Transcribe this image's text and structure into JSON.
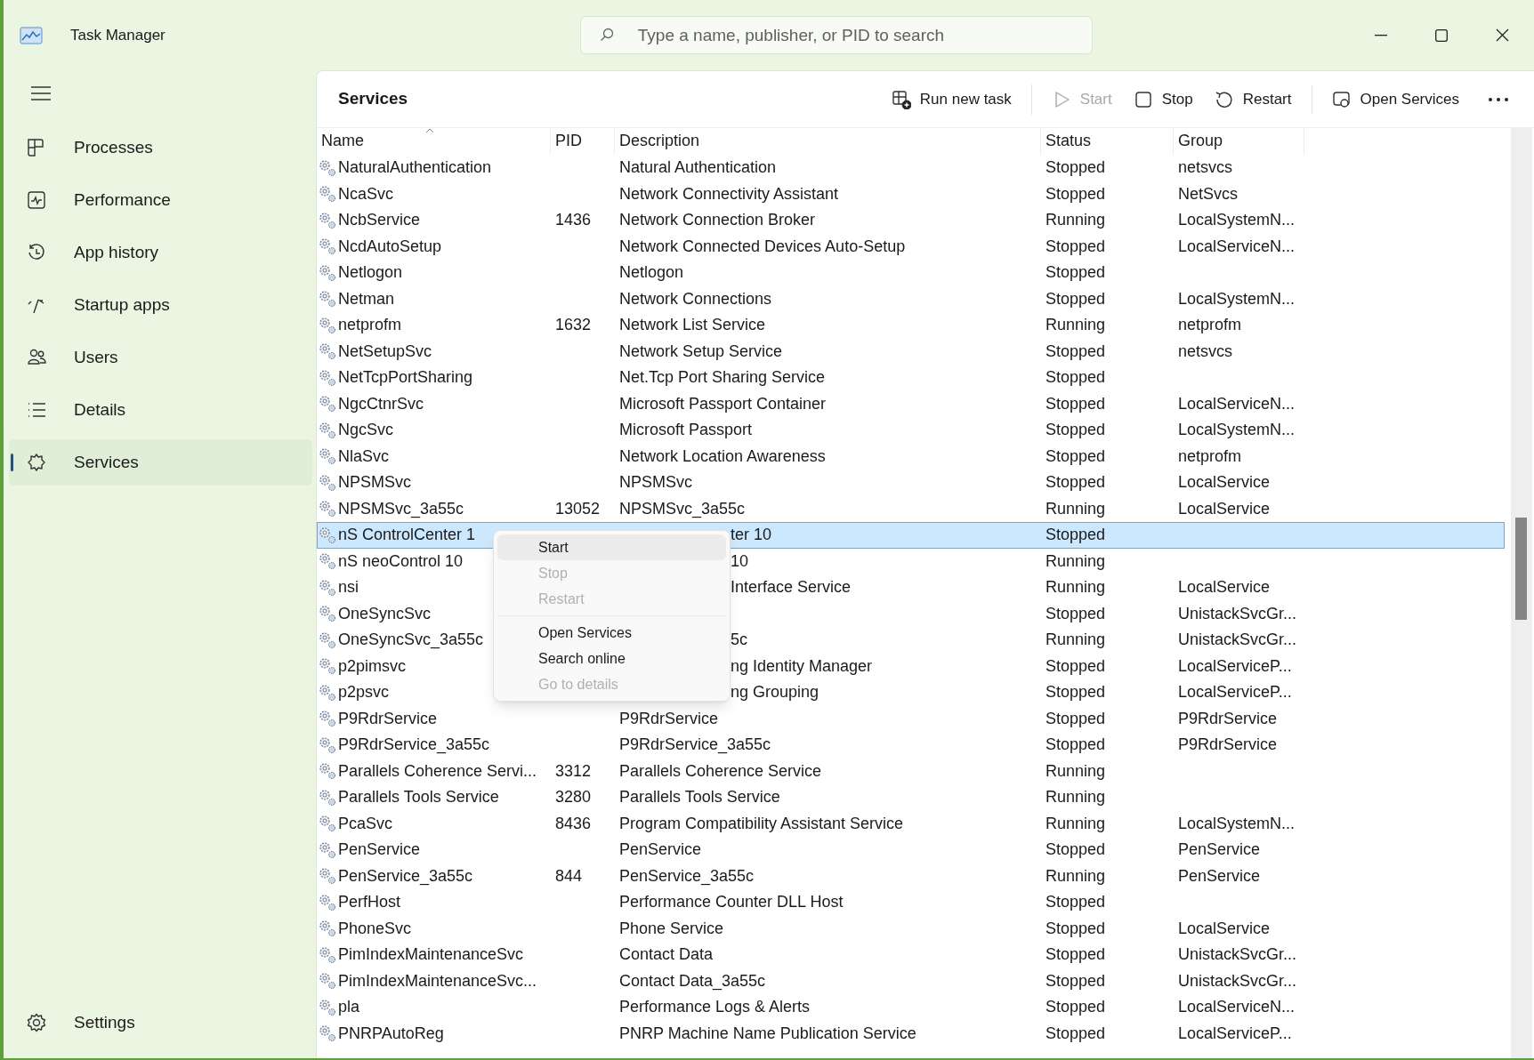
{
  "window": {
    "title": "Task Manager"
  },
  "search": {
    "placeholder": "Type a name, publisher, or PID to search"
  },
  "sidebar": {
    "items": [
      {
        "label": "Processes",
        "selected": false
      },
      {
        "label": "Performance",
        "selected": false
      },
      {
        "label": "App history",
        "selected": false
      },
      {
        "label": "Startup apps",
        "selected": false
      },
      {
        "label": "Users",
        "selected": false
      },
      {
        "label": "Details",
        "selected": false
      },
      {
        "label": "Services",
        "selected": true
      }
    ],
    "settings": "Settings"
  },
  "page_title": "Services",
  "toolbar": [
    {
      "label": "Run new task",
      "disabled": false
    },
    {
      "label": "Start",
      "disabled": true
    },
    {
      "label": "Stop",
      "disabled": false
    },
    {
      "label": "Restart",
      "disabled": false
    },
    {
      "label": "Open Services",
      "disabled": false
    }
  ],
  "table": {
    "columns": [
      "Name",
      "PID",
      "Description",
      "Status",
      "Group"
    ],
    "rows": [
      {
        "name": "NaturalAuthentication",
        "description": "Natural Authentication",
        "status": "Stopped",
        "group": "netsvcs",
        "selected": false
      },
      {
        "name": "NcaSvc",
        "description": "Network Connectivity Assistant",
        "status": "Stopped",
        "group": "NetSvcs",
        "selected": false
      },
      {
        "name": "NcbService",
        "pid": "1436",
        "description": "Network Connection Broker",
        "status": "Running",
        "group": "LocalSystemN...",
        "selected": false
      },
      {
        "name": "NcdAutoSetup",
        "description": "Network Connected Devices Auto-Setup",
        "status": "Stopped",
        "group": "LocalServiceN...",
        "selected": false
      },
      {
        "name": "Netlogon",
        "description": "Netlogon",
        "status": "Stopped",
        "selected": false
      },
      {
        "name": "Netman",
        "description": "Network Connections",
        "status": "Stopped",
        "group": "LocalSystemN...",
        "selected": false
      },
      {
        "name": "netprofm",
        "pid": "1632",
        "description": "Network List Service",
        "status": "Running",
        "group": "netprofm",
        "selected": false
      },
      {
        "name": "NetSetupSvc",
        "description": "Network Setup Service",
        "status": "Stopped",
        "group": "netsvcs",
        "selected": false
      },
      {
        "name": "NetTcpPortSharing",
        "description": "Net.Tcp Port Sharing Service",
        "status": "Stopped",
        "selected": false
      },
      {
        "name": "NgcCtnrSvc",
        "description": "Microsoft Passport Container",
        "status": "Stopped",
        "group": "LocalServiceN...",
        "selected": false
      },
      {
        "name": "NgcSvc",
        "description": "Microsoft Passport",
        "status": "Stopped",
        "group": "LocalSystemN...",
        "selected": false
      },
      {
        "name": "NlaSvc",
        "description": "Network Location Awareness",
        "status": "Stopped",
        "group": "netprofm",
        "selected": false
      },
      {
        "name": "NPSMSvc",
        "description": "NPSMSvc",
        "status": "Stopped",
        "group": "LocalService",
        "selected": false
      },
      {
        "name": "NPSMSvc_3a55c",
        "pid": "13052",
        "description": "NPSMSvc_3a55c",
        "status": "Running",
        "group": "LocalService",
        "selected": false
      },
      {
        "name": "nS ControlCenter 1",
        "description": "ter 10",
        "description_cut": true,
        "status": "Stopped",
        "selected": true
      },
      {
        "name": "nS neoControl 10",
        "description": "10",
        "description_cut": true,
        "status": "Running",
        "selected": false
      },
      {
        "name": "nsi",
        "description": "Interface Service",
        "description_cut": true,
        "status": "Running",
        "group": "LocalService",
        "selected": false
      },
      {
        "name": "OneSyncSvc",
        "status": "Stopped",
        "group": "UnistackSvcGr...",
        "selected": false
      },
      {
        "name": "OneSyncSvc_3a55c",
        "description": "5c",
        "description_cut": true,
        "status": "Running",
        "group": "UnistackSvcGr...",
        "selected": false
      },
      {
        "name": "p2pimsvc",
        "description": "ng Identity Manager",
        "description_cut": true,
        "status": "Stopped",
        "group": "LocalServiceP...",
        "selected": false
      },
      {
        "name": "p2psvc",
        "description": "ng Grouping",
        "description_cut": true,
        "status": "Stopped",
        "group": "LocalServiceP...",
        "selected": false
      },
      {
        "name": "P9RdrService",
        "description": "P9RdrService",
        "status": "Stopped",
        "group": "P9RdrService",
        "selected": false
      },
      {
        "name": "P9RdrService_3a55c",
        "description": "P9RdrService_3a55c",
        "status": "Stopped",
        "group": "P9RdrService",
        "selected": false
      },
      {
        "name": "Parallels Coherence Servi...",
        "pid": "3312",
        "description": "Parallels Coherence Service",
        "status": "Running",
        "selected": false
      },
      {
        "name": "Parallels Tools Service",
        "pid": "3280",
        "description": "Parallels Tools Service",
        "status": "Running",
        "selected": false
      },
      {
        "name": "PcaSvc",
        "pid": "8436",
        "description": "Program Compatibility Assistant Service",
        "status": "Running",
        "group": "LocalSystemN...",
        "selected": false
      },
      {
        "name": "PenService",
        "description": "PenService",
        "status": "Stopped",
        "group": "PenService",
        "selected": false
      },
      {
        "name": "PenService_3a55c",
        "pid": "844",
        "description": "PenService_3a55c",
        "status": "Running",
        "group": "PenService",
        "selected": false
      },
      {
        "name": "PerfHost",
        "description": "Performance Counter DLL Host",
        "status": "Stopped",
        "selected": false
      },
      {
        "name": "PhoneSvc",
        "description": "Phone Service",
        "status": "Stopped",
        "group": "LocalService",
        "selected": false
      },
      {
        "name": "PimIndexMaintenanceSvc",
        "description": "Contact Data",
        "status": "Stopped",
        "group": "UnistackSvcGr...",
        "selected": false
      },
      {
        "name": "PimIndexMaintenanceSvc...",
        "description": "Contact Data_3a55c",
        "status": "Stopped",
        "group": "UnistackSvcGr...",
        "selected": false
      },
      {
        "name": "pla",
        "description": "Performance Logs & Alerts",
        "status": "Stopped",
        "group": "LocalServiceN...",
        "selected": false
      },
      {
        "name": "PNRPAutoReg",
        "description": "PNRP Machine Name Publication Service",
        "status": "Stopped",
        "group": "LocalServiceP...",
        "selected": false
      }
    ]
  },
  "context_menu": {
    "items": [
      {
        "label": "Start",
        "disabled": false,
        "hovered": true
      },
      {
        "label": "Stop",
        "disabled": true,
        "hovered": false
      },
      {
        "label": "Restart",
        "disabled": true,
        "hovered": false
      },
      {
        "kind": "separator"
      },
      {
        "label": "Open Services",
        "disabled": false,
        "hovered": false
      },
      {
        "label": "Search online",
        "disabled": false,
        "hovered": false
      },
      {
        "label": "Go to details",
        "disabled": true,
        "hovered": false
      }
    ]
  }
}
